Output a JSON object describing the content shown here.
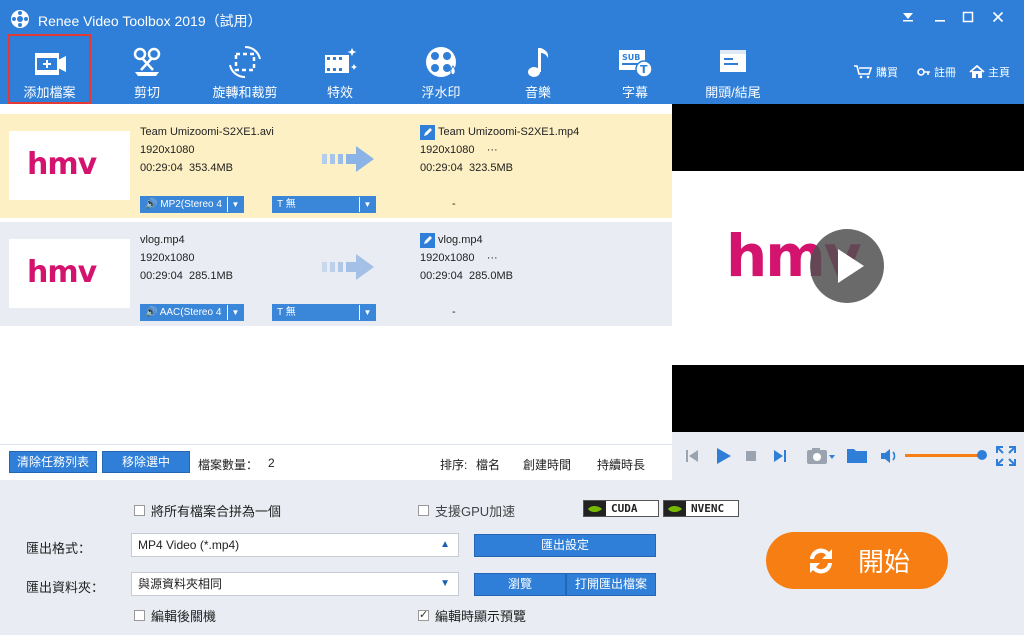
{
  "window": {
    "title": "Renee Video Toolbox 2019（試用）",
    "controls": [
      "menu",
      "minimize",
      "maximize",
      "close"
    ]
  },
  "toolbar": {
    "items": [
      {
        "label": "添加檔案",
        "icon": "add-file-icon"
      },
      {
        "label": "剪切",
        "icon": "scissors-icon"
      },
      {
        "label": "旋轉和裁剪",
        "icon": "rotate-crop-icon"
      },
      {
        "label": "特效",
        "icon": "effects-icon"
      },
      {
        "label": "浮水印",
        "icon": "watermark-icon"
      },
      {
        "label": "音樂",
        "icon": "music-note-icon"
      },
      {
        "label": "字幕",
        "icon": "subtitle-icon"
      },
      {
        "label": "開頭/結尾",
        "icon": "intro-outro-icon"
      }
    ],
    "right": {
      "buy": "購買",
      "register": "註冊",
      "home": "主頁"
    }
  },
  "files": [
    {
      "thumb_text": "hmv",
      "src": {
        "name": "Team Umizoomi-S2XE1.avi",
        "res": "1920x1080",
        "duration": "00:29:04",
        "size": "353.4MB"
      },
      "dst": {
        "name": "Team Umizoomi-S2XE1.mp4",
        "res": "1920x1080",
        "more": "···",
        "duration": "00:29:04",
        "size": "323.5MB"
      },
      "audio": "MP2(Stereo 4",
      "subtitle": "T 無",
      "extra": "-"
    },
    {
      "thumb_text": "hmv",
      "src": {
        "name": "vlog.mp4",
        "res": "1920x1080",
        "duration": "00:29:04",
        "size": "285.1MB"
      },
      "dst": {
        "name": "vlog.mp4",
        "res": "1920x1080",
        "more": "···",
        "duration": "00:29:04",
        "size": "285.0MB"
      },
      "audio": "AAC(Stereo 4",
      "subtitle": "T 無",
      "extra": "-"
    }
  ],
  "listfooter": {
    "clear_btn": "清除任務列表",
    "remove_btn": "移除選中",
    "count_label": "檔案數量：",
    "count": "2",
    "sort_label": "排序:",
    "sort_name": "檔名",
    "sort_created": "創建時間",
    "sort_duration": "持續時長"
  },
  "preview": {
    "logo_text": "hmv"
  },
  "settings": {
    "merge_all": "將所有檔案合拼為一個",
    "gpu": "支援GPU加速",
    "cuda": "CUDA",
    "nvenc": "NVENC",
    "format_label": "匯出格式：",
    "format_value": "MP4 Video (*.mp4)",
    "export_settings_btn": "匯出設定",
    "folder_label": "匯出資料夾：",
    "folder_value": "與源資料夾相同",
    "browse_btn": "瀏覽",
    "open_folder_btn": "打開匯出檔案",
    "shutdown": "編輯後關機",
    "preview_when_edit": "編輯時顯示預覽",
    "start_btn": "開始"
  },
  "colors": {
    "primary": "#2f7fd8",
    "selected_row": "#fdf0c4",
    "start": "#f77e12",
    "logo": "#d4136e"
  }
}
